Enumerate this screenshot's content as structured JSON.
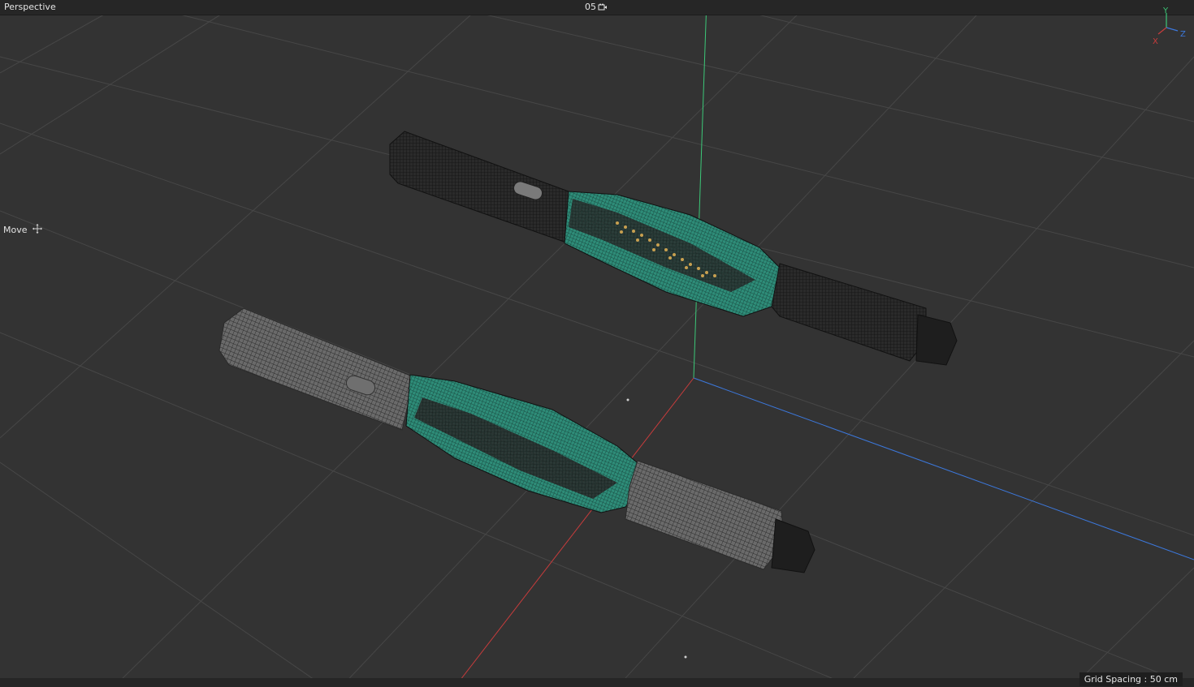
{
  "viewport": {
    "view_name": "Perspective",
    "camera_label": "05",
    "camera_icon": "camera-icon",
    "active_tool": "Move",
    "active_tool_icon": "move-icon",
    "grid_spacing_text": "Grid Spacing : 50 cm",
    "axis_gizmo": {
      "x": "X",
      "y": "Y",
      "z": "Z"
    }
  },
  "colors": {
    "background": "#333333",
    "grid_line": "#484848",
    "axis_x": "#c83c3c",
    "axis_y": "#3cc878",
    "axis_z": "#3c78dc",
    "wire_dark": "#1a1a1a",
    "wire_light": "#5a5a5a",
    "wire_teal": "#2e8c78",
    "highlight_orange": "#c8a050"
  }
}
